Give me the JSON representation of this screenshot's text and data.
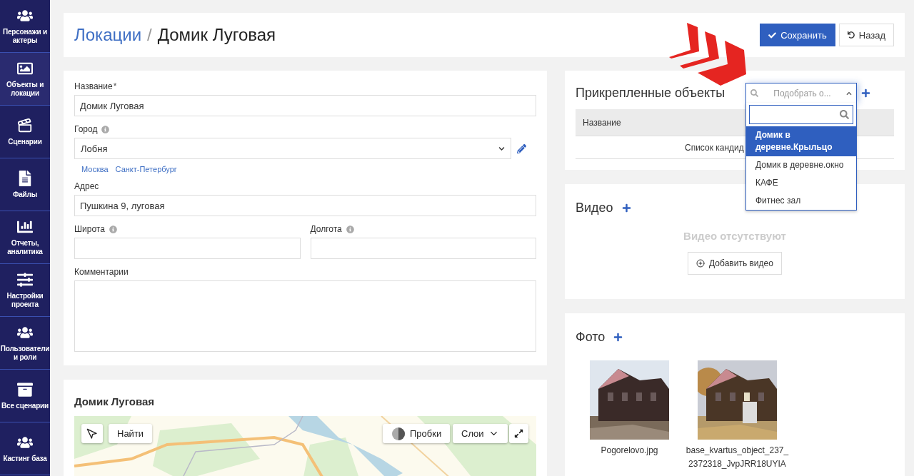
{
  "sidebar": {
    "items": [
      {
        "label": "Персонажи и актеры",
        "selected": false
      },
      {
        "label": "Объекты и локации",
        "selected": true
      },
      {
        "label": "Сценарии",
        "selected": false
      },
      {
        "label": "Файлы",
        "selected": false
      },
      {
        "label": "Отчеты, аналитика",
        "selected": false
      },
      {
        "label": "Настройки проекта",
        "selected": false
      },
      {
        "label": "Пользователи и роли",
        "selected": false
      },
      {
        "label": "Все сценарии",
        "selected": false
      },
      {
        "label": "Кастинг база",
        "selected": false
      }
    ]
  },
  "header": {
    "breadcrumb": "Локации",
    "separator": "/",
    "title": "Домик Луговая",
    "buttons": [
      {
        "label": "Сохранить",
        "kind": "primary"
      },
      {
        "label": "Назад",
        "kind": "back"
      }
    ]
  },
  "location_form": {
    "name": {
      "label": "Название",
      "required_mark": "*",
      "value": "Домик Луговая"
    },
    "city": {
      "label": "Город",
      "value": "Лобня",
      "suggestions": [
        "Москва",
        "Санкт-Петербург"
      ]
    },
    "address": {
      "label": "Адрес",
      "value": "Пушкина 9, луговая"
    },
    "latitude": {
      "label": "Широта"
    },
    "longitude": {
      "label": "Долгота"
    },
    "comments": {
      "label": "Комментарии"
    }
  },
  "map_card": {
    "title": "Домик Луговая",
    "controls": [
      {
        "kind": "locate"
      },
      {
        "kind": "search",
        "label": "Найти"
      },
      {
        "kind": "traffic",
        "label": "Пробки"
      },
      {
        "kind": "layers",
        "label": "Слои"
      },
      {
        "kind": "fullscreen"
      }
    ]
  },
  "attached_objects": {
    "title": "Прикрепленные объекты",
    "picker": {
      "placeholder": "Подобрать о...",
      "expanded": true,
      "options": [
        {
          "label": "Домик в деревне.Крыльцо",
          "selected": true
        },
        {
          "label": "Домик в деревне.окно",
          "selected": false
        },
        {
          "label": "КАФЕ",
          "selected": false
        },
        {
          "label": "Фитнес зал",
          "selected": false
        }
      ]
    },
    "table": {
      "columns": [
        "Название"
      ],
      "empty_text": "Список кандид"
    }
  },
  "video": {
    "title": "Видео",
    "empty_text": "Видео отсутствуют",
    "add_button": "Добавить видео"
  },
  "photos": {
    "title": "Фото",
    "items": [
      {
        "caption": "Pogorelovo.jpg",
        "kind": "picture"
      },
      {
        "caption": "base_kvartus_object_237_2372318_JvpJRR18UYIA",
        "kind": "picture"
      }
    ]
  }
}
